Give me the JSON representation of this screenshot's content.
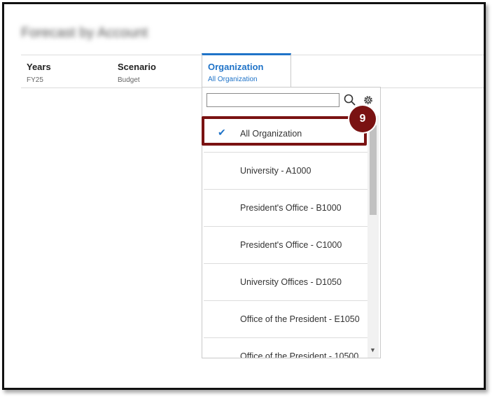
{
  "page_title": "Forecast by Account",
  "pov": [
    {
      "label": "Years",
      "value": "FY25"
    },
    {
      "label": "Scenario",
      "value": "Budget"
    },
    {
      "label": "Organization",
      "value": "All Organization"
    }
  ],
  "dropdown": {
    "search_value": "",
    "items": [
      {
        "label": "All Organization",
        "selected": true
      },
      {
        "label": "University - A1000"
      },
      {
        "label": "President's Office - B1000"
      },
      {
        "label": "President's Office - C1000"
      },
      {
        "label": "University Offices - D1050"
      },
      {
        "label": "Office of the President - E1050"
      },
      {
        "label": "Office of the President - 10500"
      }
    ]
  },
  "callout": {
    "step": "9",
    "color": "#7a1212"
  },
  "colors": {
    "accent": "#1f73c8",
    "callout": "#7a1212"
  }
}
